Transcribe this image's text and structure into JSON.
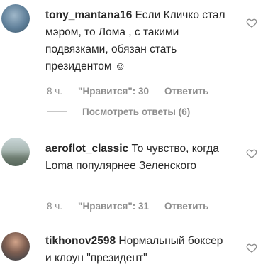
{
  "comments": [
    {
      "username": "tony_mantana16",
      "text": "Если Кличко стал мэром, то Лома , с такими подвязками, обязан стать президентом ☺",
      "time": "8 ч.",
      "likes": "\"Нравится\": 30",
      "reply": "Ответить",
      "view_replies": "Посмотреть ответы (6)",
      "heart_icon": "heart-outline-icon"
    },
    {
      "username": "aeroflot_classic",
      "text": "То чувство, когда Loma популярнее Зеленского",
      "time": "8 ч.",
      "likes": "\"Нравится\": 31",
      "reply": "Ответить",
      "heart_icon": "heart-outline-icon"
    },
    {
      "username": "tikhonov2598",
      "text": "Нормальный боксер и клоун \"президент\"",
      "heart_icon": "heart-outline-icon"
    }
  ]
}
